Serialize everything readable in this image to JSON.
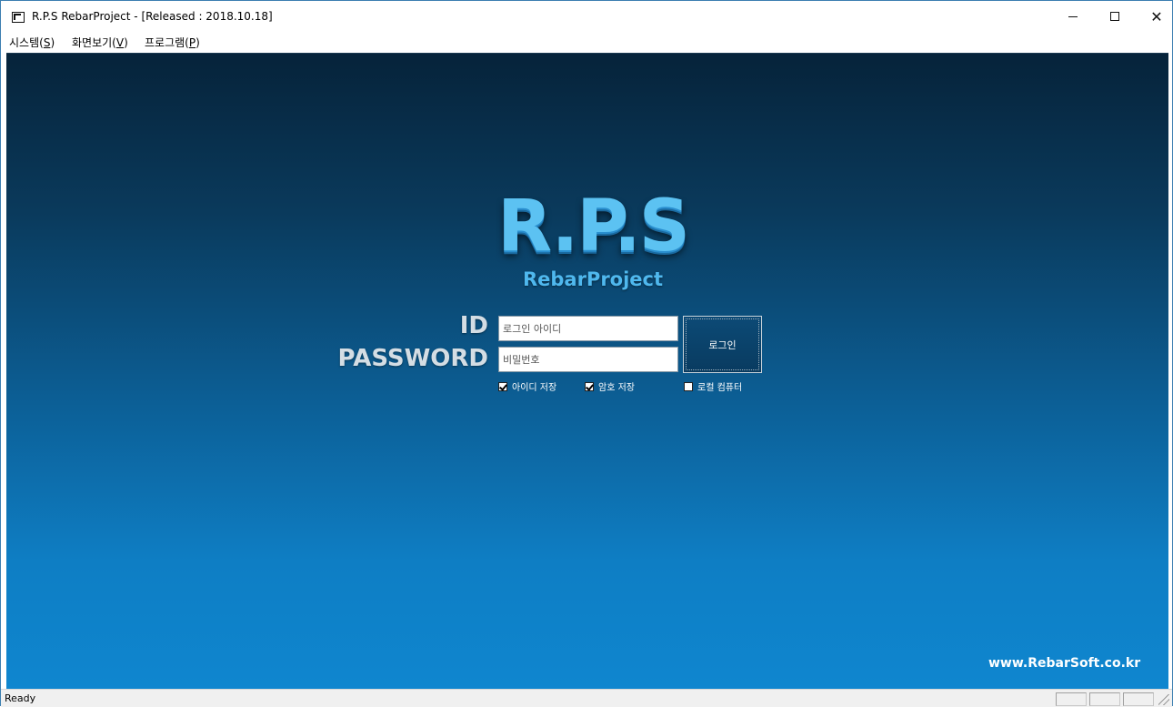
{
  "window": {
    "title": "R.P.S RebarProject - [Released : 2018.10.18]"
  },
  "menu": [
    {
      "label": "시스템(",
      "accel": "S",
      "end": ")"
    },
    {
      "label": "화면보기(",
      "accel": "V",
      "end": ")"
    },
    {
      "label": "프로그램(",
      "accel": "P",
      "end": ")"
    }
  ],
  "logo": {
    "main": "R.P.S",
    "sub": "RebarProject"
  },
  "login": {
    "id_label": "ID",
    "password_label": "PASSWORD",
    "id_placeholder": "로그인 아이디",
    "password_placeholder": "비밀번호",
    "login_button": "로그인",
    "save_id": {
      "label": "아이디 저장",
      "checked": true
    },
    "save_password": {
      "label": "암호 저장",
      "checked": true
    },
    "local_computer": {
      "label": "로컬 컴퓨터",
      "checked": false
    }
  },
  "website": "www.RebarSoft.co.kr",
  "status": {
    "text": "Ready"
  },
  "colors": {
    "background_top": "#06233a",
    "background_bottom": "#0f86cf",
    "logo": "#5cc2f2"
  }
}
